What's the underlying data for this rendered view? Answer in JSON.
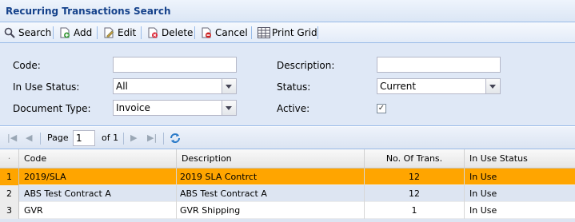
{
  "window": {
    "title": "Recurring Transactions Search"
  },
  "toolbar": {
    "search": "Search",
    "add": "Add",
    "edit": "Edit",
    "delete": "Delete",
    "cancel": "Cancel",
    "print_grid": "Print Grid"
  },
  "form": {
    "code_label": "Code:",
    "code_value": "",
    "description_label": "Description:",
    "description_value": "",
    "in_use_status_label": "In Use Status:",
    "in_use_status_value": "All",
    "status_label": "Status:",
    "status_value": "Current",
    "document_type_label": "Document Type:",
    "document_type_value": "Invoice",
    "active_label": "Active:",
    "active_checked": true
  },
  "pager": {
    "page_label": "Page",
    "page_value": "1",
    "of_label": "of 1"
  },
  "grid": {
    "columns": [
      "Code",
      "Description",
      "No. Of Trans.",
      "In Use Status"
    ],
    "rows": [
      {
        "n": "1",
        "code": "2019/SLA",
        "description": "2019 SLA Contrct",
        "trans": "12",
        "in_use": "In Use"
      },
      {
        "n": "2",
        "code": "ABS Test Contract A",
        "description": "ABS Test Contract A",
        "trans": "12",
        "in_use": "In Use"
      },
      {
        "n": "3",
        "code": "GVR",
        "description": "GVR Shipping",
        "trans": "1",
        "in_use": "In Use"
      }
    ]
  },
  "colors": {
    "selected_row": "#ffa500",
    "alt_row": "#dde5f2",
    "panel": "#dfe8f6",
    "header_text": "#15428b"
  }
}
